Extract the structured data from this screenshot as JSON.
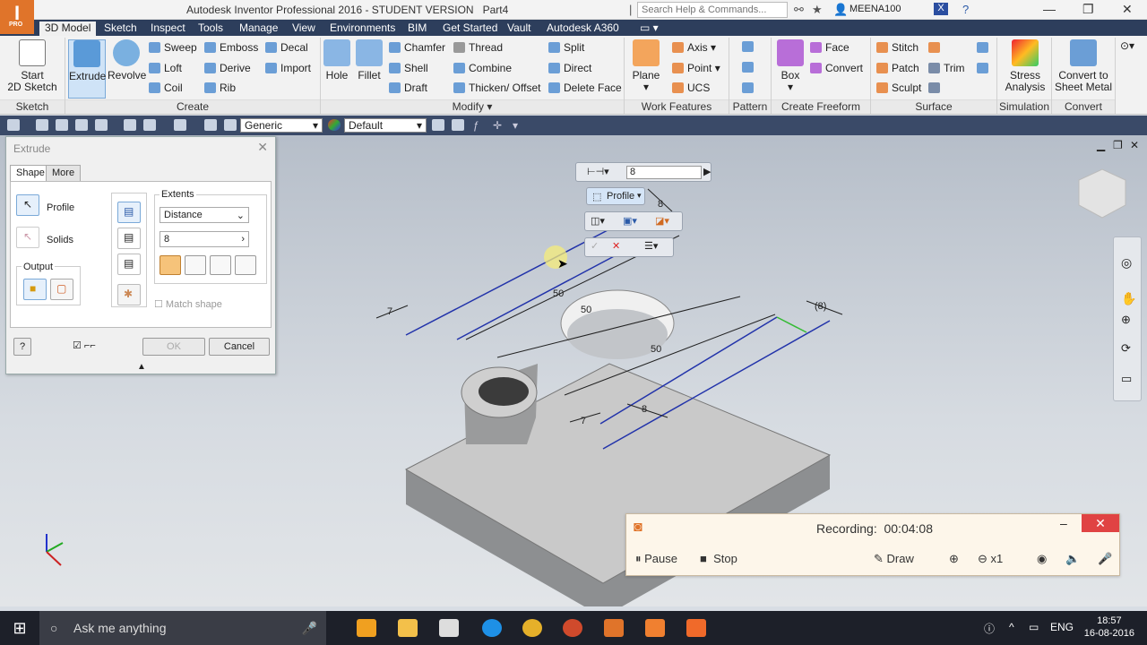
{
  "title_bar": {
    "app_badge": "I",
    "app_badge_sub": "PRO",
    "title": "Autodesk Inventor Professional 2016 - STUDENT VERSION",
    "document": "Part4",
    "search_placeholder": "Search Help & Commands...",
    "user": "MEENA100"
  },
  "tabs": [
    "3D Model",
    "Sketch",
    "Inspect",
    "Tools",
    "Manage",
    "View",
    "Environments",
    "BIM",
    "Get Started",
    "Vault",
    "Autodesk A360"
  ],
  "ribbon": {
    "sketch": {
      "start_label_1": "Start",
      "start_label_2": "2D Sketch",
      "panel": "Sketch"
    },
    "create": {
      "extrude": "Extrude",
      "revolve": "Revolve",
      "sweep": "Sweep",
      "loft": "Loft",
      "coil": "Coil",
      "emboss": "Emboss",
      "derive": "Derive",
      "rib": "Rib",
      "decal": "Decal",
      "import": "Import",
      "panel": "Create"
    },
    "modify": {
      "hole": "Hole",
      "fillet": "Fillet",
      "chamfer": "Chamfer",
      "shell": "Shell",
      "draft": "Draft",
      "thread": "Thread",
      "combine": "Combine",
      "thicken": "Thicken/ Offset",
      "split": "Split",
      "direct": "Direct",
      "delete_face": "Delete Face",
      "panel": "Modify"
    },
    "work": {
      "plane": "Plane",
      "axis": "Axis",
      "point": "Point",
      "ucs": "UCS",
      "panel": "Work Features"
    },
    "pattern": {
      "panel": "Pattern"
    },
    "freeform": {
      "box": "Box",
      "face": "Face",
      "convert": "Convert",
      "panel": "Create Freeform"
    },
    "surface": {
      "stitch": "Stitch",
      "patch": "Patch",
      "sculpt": "Sculpt",
      "trim": "Trim",
      "panel": "Surface"
    },
    "simulation": {
      "stress_1": "Stress",
      "stress_2": "Analysis",
      "panel": "Simulation"
    },
    "convert": {
      "sheet_1": "Convert to",
      "sheet_2": "Sheet Metal",
      "panel": "Convert"
    }
  },
  "quick_access": {
    "material": "Generic",
    "appearance": "Default"
  },
  "extrude_dialog": {
    "title": "Extrude",
    "tab_shape": "Shape",
    "tab_more": "More",
    "profile": "Profile",
    "solids": "Solids",
    "output": "Output",
    "extents": "Extents",
    "extents_value": "Distance",
    "distance": "8",
    "match_shape": "Match shape",
    "ok": "OK",
    "cancel": "Cancel"
  },
  "minitoolbar": {
    "distance": "8",
    "profile": "Profile"
  },
  "dimensions": {
    "d1": "50",
    "d2": "50",
    "d3": "50",
    "d4": "(8)",
    "d5": "8",
    "d6": "8",
    "d7": "7",
    "d8": "7"
  },
  "recorder": {
    "title": "Recording:",
    "time": "00:04:08",
    "pause": "Pause",
    "stop": "Stop",
    "draw": "Draw",
    "zoom": "x1"
  },
  "taskbar": {
    "search": "Ask me anything",
    "lang": "ENG",
    "time": "18:57",
    "date": "16-08-2016"
  },
  "colors": {
    "accent": "#2d3e5c",
    "brand": "#e0742a",
    "record": "#e04343"
  }
}
